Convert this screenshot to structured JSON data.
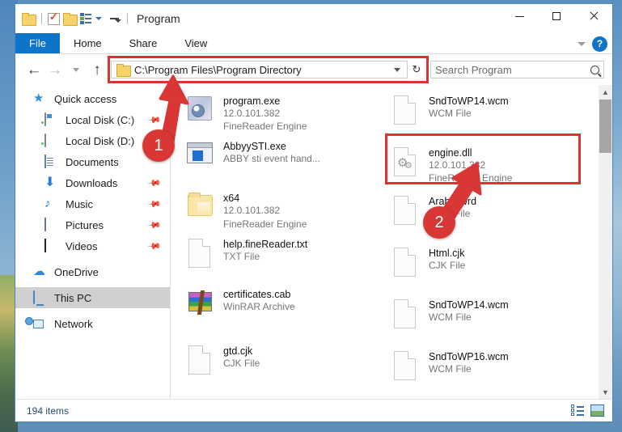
{
  "window": {
    "title": "Program",
    "quick_access": [
      {
        "name": "folder-icon",
        "label": "Folder"
      },
      {
        "name": "properties-icon",
        "label": "Properties"
      },
      {
        "name": "new-folder-icon",
        "label": "New folder"
      },
      {
        "name": "customize-view-icon",
        "label": "Customize Quick Access Toolbar"
      }
    ],
    "controls": {
      "minimize": "Minimize",
      "maximize": "Maximize",
      "close": "Close"
    }
  },
  "ribbon": {
    "tabs": [
      {
        "label": "File",
        "active": true
      },
      {
        "label": "Home",
        "active": false
      },
      {
        "label": "Share",
        "active": false
      },
      {
        "label": "View",
        "active": false
      }
    ],
    "collapse_label": "Minimize the Ribbon",
    "help_label": "?"
  },
  "navbar": {
    "back_label": "←",
    "forward_label": "→",
    "recent_label": "⌄",
    "up_label": "↑",
    "address_value": "C:\\Program Files\\Program Directory",
    "address_dropdown": "⌄",
    "refresh_label": "↻",
    "search_placeholder": "Search Program",
    "search_value": ""
  },
  "sidebar": {
    "items": [
      {
        "label": "Quick access",
        "icon": "star-icon",
        "indent": false,
        "pinned": false,
        "selected": false
      },
      {
        "label": "Local Disk (C:)",
        "icon": "drive-c-icon",
        "indent": true,
        "pinned": true,
        "selected": false
      },
      {
        "label": "Local Disk (D:)",
        "icon": "drive-d-icon",
        "indent": true,
        "pinned": false,
        "selected": false
      },
      {
        "label": "Documents",
        "icon": "documents-icon",
        "indent": true,
        "pinned": false,
        "selected": false
      },
      {
        "label": "Downloads",
        "icon": "downloads-icon",
        "indent": true,
        "pinned": true,
        "selected": false
      },
      {
        "label": "Music",
        "icon": "music-icon",
        "indent": true,
        "pinned": true,
        "selected": false
      },
      {
        "label": "Pictures",
        "icon": "pictures-icon",
        "indent": true,
        "pinned": true,
        "selected": false
      },
      {
        "label": "Videos",
        "icon": "videos-icon",
        "indent": true,
        "pinned": true,
        "selected": false
      },
      {
        "label": "OneDrive",
        "icon": "onedrive-icon",
        "indent": false,
        "pinned": false,
        "selected": false
      },
      {
        "label": "This PC",
        "icon": "this-pc-icon",
        "indent": false,
        "pinned": false,
        "selected": true
      },
      {
        "label": "Network",
        "icon": "network-icon",
        "indent": false,
        "pinned": false,
        "selected": false
      }
    ]
  },
  "files": {
    "column1": [
      {
        "name": "program.exe",
        "line2": "12.0.101.382",
        "line3": "FineReader Engine",
        "icon": "program-exe-icon"
      },
      {
        "name": "AbbyySTI.exe",
        "line2": "ABBY sti event hand...",
        "line3": "",
        "icon": "abbyy-exe-icon"
      },
      {
        "name": "x64",
        "line2": "12.0.101.382",
        "line3": "FineReader Engine",
        "icon": "folder-icon"
      },
      {
        "name": "help.fineReader.txt",
        "line2": "TXT File",
        "line3": "",
        "icon": "text-file-icon"
      },
      {
        "name": "certificates.cab",
        "line2": "WinRAR Archive",
        "line3": "",
        "icon": "winrar-archive-icon"
      },
      {
        "name": "gtd.cjk",
        "line2": "CJK File",
        "line3": "",
        "icon": "blank-file-icon"
      }
    ],
    "column2": [
      {
        "name": "SndToWP14.wcm",
        "line2": "WCM File",
        "line3": "",
        "icon": "blank-file-icon",
        "highlighted": false
      },
      {
        "name": "engine.dll",
        "line2": "12.0.101.382",
        "line3": "FineReader Engine",
        "icon": "dll-gear-icon",
        "highlighted": true
      },
      {
        "name": "Arabic.wrd",
        "line2": "WRD File",
        "line3": "",
        "icon": "blank-file-icon",
        "highlighted": false
      },
      {
        "name": "Html.cjk",
        "line2": "CJK File",
        "line3": "",
        "icon": "blank-file-icon",
        "highlighted": false
      },
      {
        "name": "SndToWP14.wcm",
        "line2": "WCM File",
        "line3": "",
        "icon": "blank-file-icon",
        "highlighted": false
      },
      {
        "name": "SndToWP16.wcm",
        "line2": "WCM File",
        "line3": "",
        "icon": "blank-file-icon",
        "highlighted": false
      }
    ]
  },
  "statusbar": {
    "item_count": "194 items",
    "view_details_label": "Details view",
    "view_thumbnails_label": "Large icons view"
  },
  "annotations": {
    "badge1": "1",
    "badge2": "2",
    "accent_color": "#d93636",
    "highlight_color": "#e03131"
  }
}
